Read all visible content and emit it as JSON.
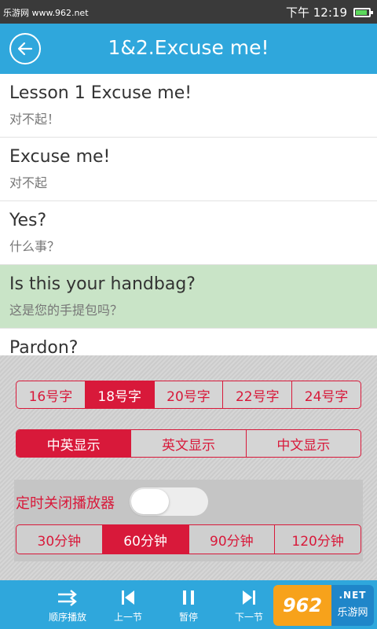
{
  "status_bar": {
    "watermark_text": "乐游网 www.962.net",
    "time": "下午 12:19"
  },
  "header": {
    "title": "1&2.Excuse me!"
  },
  "lessons": [
    {
      "en": "Lesson 1 Excuse me!",
      "zh": "对不起！",
      "active": false
    },
    {
      "en": "Excuse me!",
      "zh": "对不起",
      "active": false
    },
    {
      "en": "Yes?",
      "zh": "什么事？",
      "active": false
    },
    {
      "en": "Is this your handbag?",
      "zh": "这是您的手提包吗？",
      "active": true
    },
    {
      "en": "Pardon?",
      "zh": "",
      "active": false
    }
  ],
  "settings": {
    "font_sizes": [
      "16号字",
      "18号字",
      "20号字",
      "22号字",
      "24号字"
    ],
    "font_size_selected": "18号字",
    "display_modes": [
      "中英显示",
      "英文显示",
      "中文显示"
    ],
    "display_mode_selected": "中英显示",
    "timer_label": "定时关闭播放器",
    "timer_enabled": false,
    "timer_options": [
      "30分钟",
      "60分钟",
      "90分钟",
      "120分钟"
    ],
    "timer_selected": "60分钟"
  },
  "toolbar": {
    "items": [
      {
        "label": "顺序播放",
        "icon": "shuffle-arrows-icon"
      },
      {
        "label": "上一节",
        "icon": "previous-icon"
      },
      {
        "label": "暂停",
        "icon": "pause-icon"
      },
      {
        "label": "下一节",
        "icon": "next-icon"
      }
    ]
  },
  "watermark": {
    "logo": "962",
    "net": ".NET",
    "cn": "乐游网"
  },
  "colors": {
    "primary": "#2fa7dc",
    "accent": "#d8193a",
    "highlight_row": "#c9e4c7"
  }
}
